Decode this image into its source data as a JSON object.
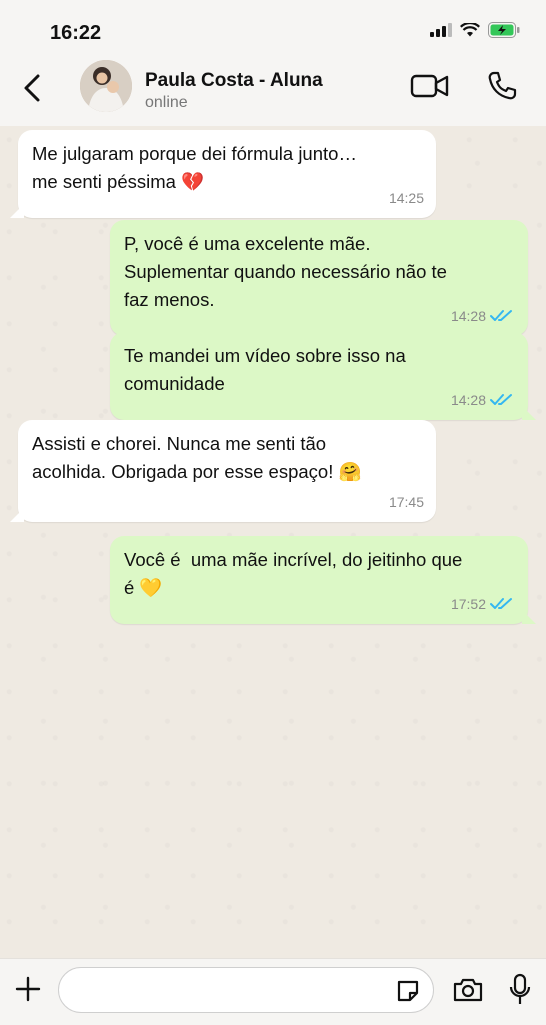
{
  "status_bar": {
    "time": "16:22"
  },
  "header": {
    "contact_name": "Paula Costa - Aluna",
    "presence": "online"
  },
  "messages": [
    {
      "direction": "in",
      "text": "Me julgaram porque dei fórmula junto…\nme senti péssima 💔",
      "time": "14:25"
    },
    {
      "direction": "out",
      "text": "P, você é uma excelente mãe.\nSuplementar quando necessário não te\nfaz menos.",
      "time": "14:28",
      "status": "read"
    },
    {
      "direction": "out",
      "text": "Te mandei um vídeo sobre isso na\ncomunidade",
      "time": "14:28",
      "status": "read"
    },
    {
      "direction": "in",
      "text": "Assisti e chorei. Nunca me senti tão\nacolhida. Obrigada por esse espaço! 🤗",
      "time": "17:45"
    },
    {
      "direction": "out",
      "text": "Você é  uma mãe incrível, do jeitinho que\né 💛",
      "time": "17:52",
      "status": "read"
    }
  ],
  "composer": {
    "placeholder": ""
  },
  "colors": {
    "incoming_bubble": "#ffffff",
    "outgoing_bubble": "#dcf8c6",
    "read_ticks": "#34b7f1",
    "battery": "#34c759"
  },
  "icons": [
    "back-chevron-icon",
    "video-call-icon",
    "phone-icon",
    "plus-icon",
    "sticker-icon",
    "camera-icon",
    "mic-icon",
    "signal-icon",
    "wifi-icon",
    "battery-icon",
    "read-ticks-icon"
  ]
}
